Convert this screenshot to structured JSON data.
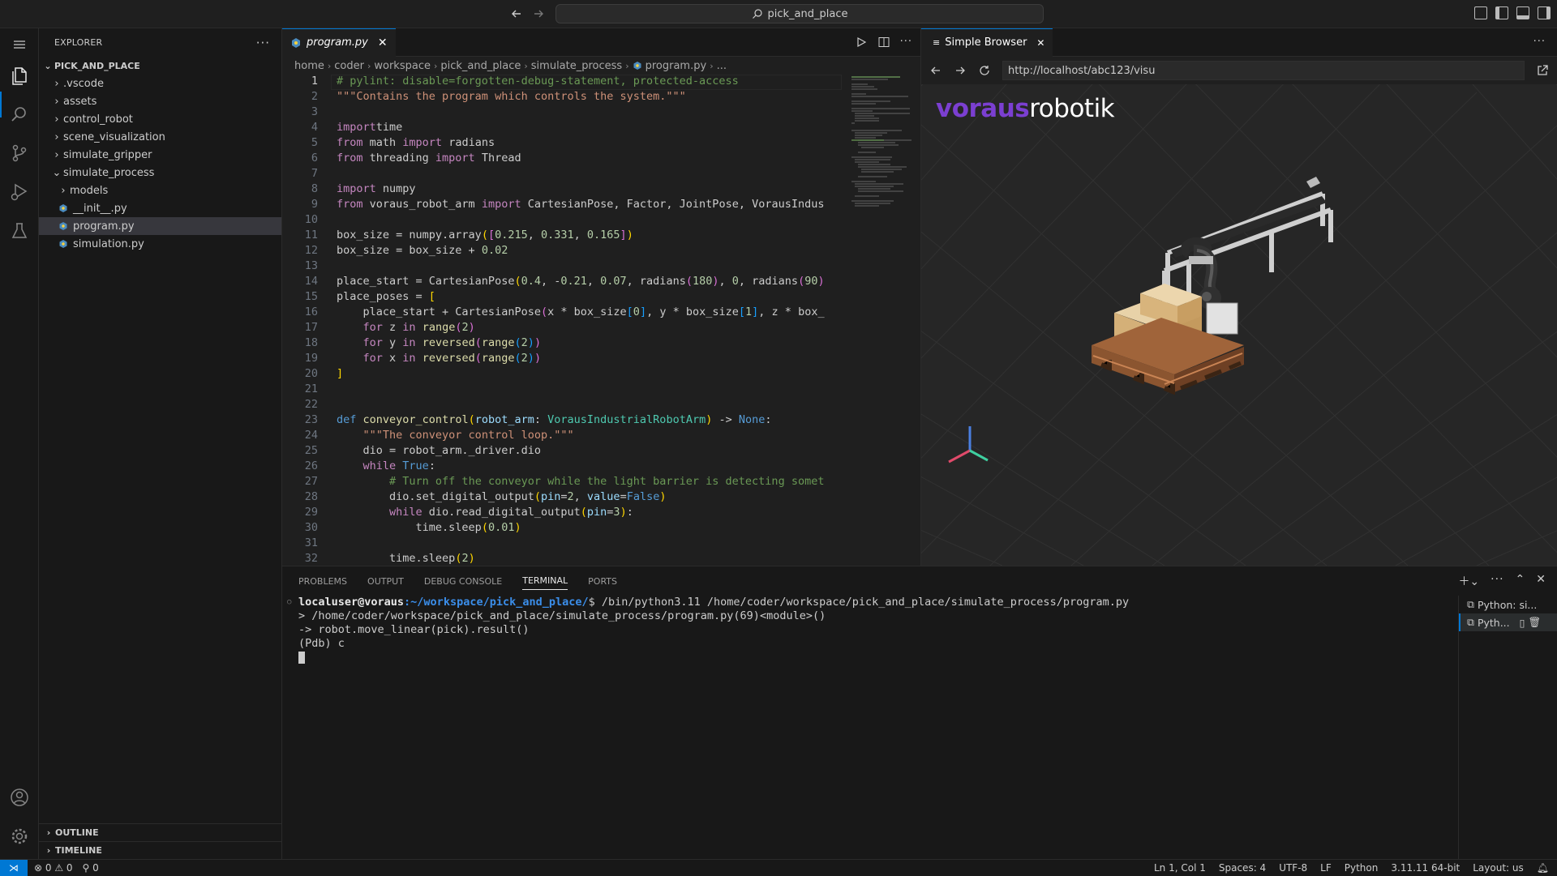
{
  "titlebar": {
    "search_text": "pick_and_place"
  },
  "activity": {
    "items": [
      "explorer-icon",
      "search-icon",
      "source-control-icon",
      "run-debug-icon",
      "testing-icon"
    ]
  },
  "sidebar": {
    "title": "EXPLORER",
    "root": "PICK_AND_PLACE",
    "items": [
      {
        "label": ".vscode",
        "type": "folder",
        "depth": 1,
        "open": false
      },
      {
        "label": "assets",
        "type": "folder",
        "depth": 1,
        "open": false
      },
      {
        "label": "control_robot",
        "type": "folder",
        "depth": 1,
        "open": false
      },
      {
        "label": "scene_visualization",
        "type": "folder",
        "depth": 1,
        "open": false
      },
      {
        "label": "simulate_gripper",
        "type": "folder",
        "depth": 1,
        "open": false
      },
      {
        "label": "simulate_process",
        "type": "folder",
        "depth": 1,
        "open": true
      },
      {
        "label": "models",
        "type": "folder",
        "depth": 2,
        "open": false
      },
      {
        "label": "__init__.py",
        "type": "py",
        "depth": 2
      },
      {
        "label": "program.py",
        "type": "py",
        "depth": 2,
        "selected": true
      },
      {
        "label": "simulation.py",
        "type": "py",
        "depth": 2
      }
    ],
    "outline": "OUTLINE",
    "timeline": "TIMELINE"
  },
  "editor": {
    "tab": "program.py",
    "breadcrumb": [
      "home",
      "coder",
      "workspace",
      "pick_and_place",
      "simulate_process",
      "program.py",
      "..."
    ],
    "lines": [
      [
        [
          "cmt",
          "# pylint: disable=forgotten-debug-statement, protected-access"
        ]
      ],
      [
        [
          "str",
          "\"\"\"Contains the program which controls the system.\"\"\""
        ]
      ],
      [],
      [
        [
          "kw",
          "import"
        ],
        [
          "",
          "time"
        ]
      ],
      [
        [
          "kw",
          "from"
        ],
        [
          "",
          " math "
        ],
        [
          "kw",
          "import"
        ],
        [
          "",
          " radians"
        ]
      ],
      [
        [
          "kw",
          "from"
        ],
        [
          "",
          " threading "
        ],
        [
          "kw",
          "import"
        ],
        [
          "",
          " Thread"
        ]
      ],
      [],
      [
        [
          "kw",
          "import"
        ],
        [
          "",
          " numpy"
        ]
      ],
      [
        [
          "kw",
          "from"
        ],
        [
          "",
          " voraus_robot_arm "
        ],
        [
          "kw",
          "import"
        ],
        [
          "",
          " CartesianPose, Factor, JointPose, VorausIndus"
        ]
      ],
      [],
      [
        [
          "",
          "box_size = numpy.array"
        ],
        [
          "br1",
          "("
        ],
        [
          "br2",
          "["
        ],
        [
          "num",
          "0.215"
        ],
        [
          "",
          ", "
        ],
        [
          "num",
          "0.331"
        ],
        [
          "",
          ", "
        ],
        [
          "num",
          "0.165"
        ],
        [
          "br2",
          "]"
        ],
        [
          "br1",
          ")"
        ]
      ],
      [
        [
          "",
          "box_size = box_size + "
        ],
        [
          "num",
          "0.02"
        ]
      ],
      [],
      [
        [
          "",
          "place_start = CartesianPose"
        ],
        [
          "br1",
          "("
        ],
        [
          "num",
          "0.4"
        ],
        [
          "",
          ", -"
        ],
        [
          "num",
          "0.21"
        ],
        [
          "",
          ", "
        ],
        [
          "num",
          "0.07"
        ],
        [
          "",
          ", radians"
        ],
        [
          "br2",
          "("
        ],
        [
          "num",
          "180"
        ],
        [
          "br2",
          ")"
        ],
        [
          "",
          ", "
        ],
        [
          "num",
          "0"
        ],
        [
          "",
          ", radians"
        ],
        [
          "br2",
          "("
        ],
        [
          "num",
          "90"
        ],
        [
          "br2",
          ")"
        ]
      ],
      [
        [
          "",
          "place_poses = "
        ],
        [
          "br1",
          "["
        ]
      ],
      [
        [
          "",
          "    place_start + CartesianPose"
        ],
        [
          "br2",
          "("
        ],
        [
          "",
          "x * box_size"
        ],
        [
          "br3",
          "["
        ],
        [
          "num",
          "0"
        ],
        [
          "br3",
          "]"
        ],
        [
          "",
          ", y * box_size"
        ],
        [
          "br3",
          "["
        ],
        [
          "num",
          "1"
        ],
        [
          "br3",
          "]"
        ],
        [
          "",
          ", z * box_"
        ]
      ],
      [
        [
          "",
          "    "
        ],
        [
          "kw",
          "for"
        ],
        [
          "",
          " z "
        ],
        [
          "kw",
          "in"
        ],
        [
          "",
          " "
        ],
        [
          "fn",
          "range"
        ],
        [
          "br2",
          "("
        ],
        [
          "num",
          "2"
        ],
        [
          "br2",
          ")"
        ]
      ],
      [
        [
          "",
          "    "
        ],
        [
          "kw",
          "for"
        ],
        [
          "",
          " y "
        ],
        [
          "kw",
          "in"
        ],
        [
          "",
          " "
        ],
        [
          "fn",
          "reversed"
        ],
        [
          "br2",
          "("
        ],
        [
          "fn",
          "range"
        ],
        [
          "br3",
          "("
        ],
        [
          "num",
          "2"
        ],
        [
          "br3",
          ")"
        ],
        [
          "br2",
          ")"
        ]
      ],
      [
        [
          "",
          "    "
        ],
        [
          "kw",
          "for"
        ],
        [
          "",
          " x "
        ],
        [
          "kw",
          "in"
        ],
        [
          "",
          " "
        ],
        [
          "fn",
          "reversed"
        ],
        [
          "br2",
          "("
        ],
        [
          "fn",
          "range"
        ],
        [
          "br3",
          "("
        ],
        [
          "num",
          "2"
        ],
        [
          "br3",
          ")"
        ],
        [
          "br2",
          ")"
        ]
      ],
      [
        [
          "br1",
          "]"
        ]
      ],
      [],
      [],
      [
        [
          "bi",
          "def"
        ],
        [
          "",
          " "
        ],
        [
          "fn",
          "conveyor_control"
        ],
        [
          "br1",
          "("
        ],
        [
          "var",
          "robot_arm"
        ],
        [
          "",
          ": "
        ],
        [
          "cls",
          "VorausIndustrialRobotArm"
        ],
        [
          "br1",
          ")"
        ],
        [
          "",
          " -> "
        ],
        [
          "bi",
          "None"
        ],
        [
          "",
          ":"
        ]
      ],
      [
        [
          "",
          "    "
        ],
        [
          "str",
          "\"\"\"The conveyor control loop.\"\"\""
        ]
      ],
      [
        [
          "",
          "    dio = robot_arm._driver.dio"
        ]
      ],
      [
        [
          "",
          "    "
        ],
        [
          "kw",
          "while"
        ],
        [
          "",
          " "
        ],
        [
          "bi",
          "True"
        ],
        [
          "",
          ":"
        ]
      ],
      [
        [
          "",
          "        "
        ],
        [
          "cmt",
          "# Turn off the conveyor while the light barrier is detecting somet"
        ]
      ],
      [
        [
          "",
          "        dio.set_digital_output"
        ],
        [
          "br1",
          "("
        ],
        [
          "var",
          "pin"
        ],
        [
          "",
          "="
        ],
        [
          "num",
          "2"
        ],
        [
          "",
          ", "
        ],
        [
          "var",
          "value"
        ],
        [
          "",
          "="
        ],
        [
          "bi",
          "False"
        ],
        [
          "br1",
          ")"
        ]
      ],
      [
        [
          "",
          "        "
        ],
        [
          "kw",
          "while"
        ],
        [
          "",
          " dio.read_digital_output"
        ],
        [
          "br1",
          "("
        ],
        [
          "var",
          "pin"
        ],
        [
          "",
          "="
        ],
        [
          "num",
          "3"
        ],
        [
          "br1",
          ")"
        ],
        [
          "",
          ":"
        ]
      ],
      [
        [
          "",
          "            time.sleep"
        ],
        [
          "br1",
          "("
        ],
        [
          "num",
          "0.01"
        ],
        [
          "br1",
          ")"
        ]
      ],
      [],
      [
        [
          "",
          "        time.sleep"
        ],
        [
          "br1",
          "("
        ],
        [
          "num",
          "2"
        ],
        [
          "br1",
          ")"
        ]
      ]
    ]
  },
  "browser": {
    "tab": "Simple Browser",
    "url": "http://localhost/abc123/visu",
    "logo_a": "voraus",
    "logo_b": "robotik"
  },
  "panel": {
    "tabs": [
      "PROBLEMS",
      "OUTPUT",
      "DEBUG CONSOLE",
      "TERMINAL",
      "PORTS"
    ],
    "active_tab": "TERMINAL",
    "prompt_user": "localuser@voraus",
    "prompt_path": ":~/workspace/pick_and_place/",
    "prompt_cmd": "$ /bin/python3.11 /home/coder/workspace/pick_and_place/simulate_process/program.py",
    "lines": [
      "> /home/coder/workspace/pick_and_place/simulate_process/program.py(69)<module>()",
      "-> robot.move_linear(pick).result()",
      "(Pdb) c"
    ],
    "terminals": [
      "Python: si...",
      "Pyth..."
    ]
  },
  "status": {
    "errors": "0",
    "warnings": "0",
    "ports": "0",
    "position": "Ln 1, Col 1",
    "spaces": "Spaces: 4",
    "encoding": "UTF-8",
    "eol": "LF",
    "language": "Python",
    "interpreter": "3.11.11 64-bit",
    "layout": "Layout: us"
  },
  "colors": {
    "accent": "#0078d4",
    "logo_purple": "#7b3fd1"
  }
}
